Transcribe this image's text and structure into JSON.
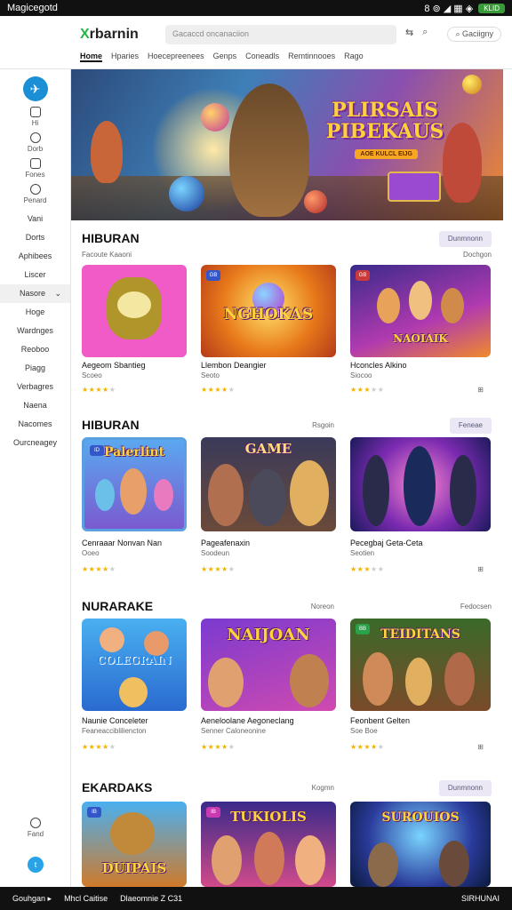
{
  "status": {
    "time": "Magicegotd",
    "icons": "8  ⊚  ◢  ▦  ◈",
    "battery": "KLID"
  },
  "header": {
    "logo_mark": "X",
    "logo_text": "rbarnin",
    "search_placeholder": "Gacaccd oncanaciion",
    "category_label": "Gaciigny",
    "nav": [
      "Home",
      "Hparies",
      "Hoecepreenees",
      "Genps",
      "Coneadls",
      "Remtinnooes",
      "Rago"
    ]
  },
  "sidebar": {
    "icons": [
      {
        "label": "Hi",
        "icon": "home-icon"
      },
      {
        "label": "Dorb",
        "icon": "chat-icon"
      },
      {
        "label": "Fones",
        "icon": "games-icon"
      },
      {
        "label": "Penard",
        "icon": "settings-icon"
      }
    ],
    "items": [
      "Vani",
      "Dorts",
      "Aphibees",
      "Liscer",
      "Nasore",
      "Hoge",
      "Wardnges",
      "Reoboo",
      "Piagg",
      "Verbagres",
      "Naena",
      "Nacomes",
      "Ourcneagey"
    ],
    "selected_index": 4,
    "help_label": "Fand",
    "twitter_label": "t"
  },
  "hero": {
    "title_line1": "PLIRSAIS",
    "title_line2": "PIBEKAUS",
    "subtitle": "AOE KULCL EIJG",
    "colors": {
      "sky": "#3e7fb7",
      "accent": "#f08a2a"
    }
  },
  "sections": [
    {
      "title": "HIBURAN",
      "subtitle": "Facoute Kaaoni",
      "right_button": "Dunmnonn",
      "right_link": "Dochgon",
      "cards": [
        {
          "title": "Aegeom Sbantieg",
          "sub": "Scoeo",
          "rating": 4,
          "thumb_text": "",
          "badge": ""
        },
        {
          "title": "Llembon Deangier",
          "sub": "Seoto",
          "rating": 4,
          "thumb_text": "NGHOKAS",
          "badge": "GB"
        },
        {
          "title": "Hconcles Alkino",
          "sub": "Siocoo",
          "rating": 3,
          "thumb_text": "NAOIAIK",
          "badge": "GB"
        }
      ]
    },
    {
      "title": "HIBURAN",
      "subtitle": "",
      "right_button": "Feneae",
      "right_link": "Rsgoin",
      "cards": [
        {
          "title": "Cenraaar Nonvan Nan",
          "sub": "Ooeo",
          "rating": 4,
          "thumb_text": "Palerlint",
          "badge": "ID"
        },
        {
          "title": "Pageafenaxin",
          "sub": "Soodeun",
          "rating": 4,
          "thumb_text": "GAME",
          "badge": ""
        },
        {
          "title": "Pecegbaj Geta-Ceta",
          "sub": "Seotien",
          "rating": 3,
          "thumb_text": "",
          "badge": ""
        }
      ]
    },
    {
      "title": "NURARAKE",
      "subtitle": "",
      "right_button": "",
      "right_link": "Noreon",
      "right_link_2": "Fedocsen",
      "cards": [
        {
          "title": "Naunie Conceleter",
          "sub": "Feaneaccibliliencton",
          "rating": 4,
          "thumb_text": "COLEGRAIN",
          "badge": ""
        },
        {
          "title": "Aeneloolane Aegoneclang",
          "sub": "Senner Caloneonine",
          "rating": 4,
          "thumb_text": "NAIJOAN",
          "badge": ""
        },
        {
          "title": "Feonbent Gelten",
          "sub": "Soe Boe",
          "rating": 4,
          "thumb_text": "TEIDITANS",
          "badge": "BB"
        }
      ]
    },
    {
      "title": "EKARDAKS",
      "subtitle": "",
      "right_button": "Dunmnonn",
      "right_link": "Kogmn",
      "cards": [
        {
          "title": "",
          "sub": "",
          "rating": 0,
          "thumb_text": "DUIPAIS",
          "badge": "IB"
        },
        {
          "title": "",
          "sub": "",
          "rating": 0,
          "thumb_text": "TUKIOLIS",
          "badge": "IB"
        },
        {
          "title": "",
          "sub": "",
          "rating": 0,
          "thumb_text": "SUROUIOS",
          "badge": ""
        }
      ]
    }
  ],
  "footer": {
    "links": [
      "Gouhgan ▸",
      "Mhcl Caitise",
      "Dlaeomnie Z C31"
    ],
    "right": "SIRHUNAI"
  }
}
